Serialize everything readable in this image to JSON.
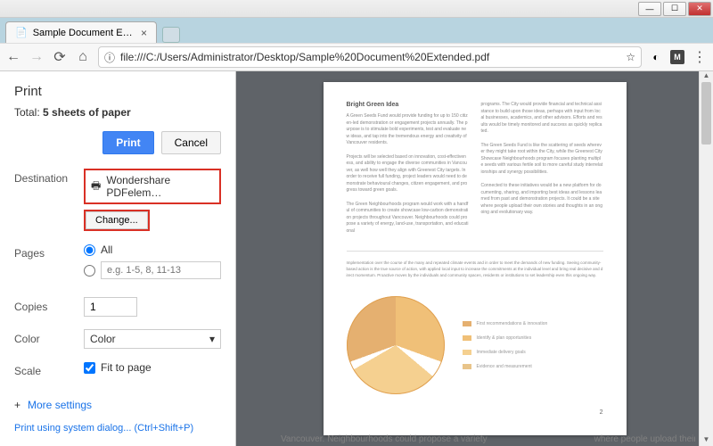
{
  "window": {
    "tab_title": "Sample Document Exte…",
    "url": "file:///C:/Users/Administrator/Desktop/Sample%20Document%20Extended.pdf"
  },
  "print": {
    "title": "Print",
    "total_prefix": "Total: ",
    "total_value": "5 sheets of paper",
    "print_btn": "Print",
    "cancel_btn": "Cancel",
    "destination_label": "Destination",
    "destination_value": "Wondershare PDFelem…",
    "change_btn": "Change...",
    "pages_label": "Pages",
    "pages_all": "All",
    "pages_range_placeholder": "e.g. 1-5, 8, 11-13",
    "copies_label": "Copies",
    "copies_value": "1",
    "color_label": "Color",
    "color_value": "Color",
    "scale_label": "Scale",
    "fit_to_page": "Fit to page",
    "more_settings": "More settings",
    "system_dialog": "Print using system dialog... (Ctrl+Shift+P)"
  },
  "preview": {
    "heading": "Bright Green Idea",
    "page_number": "2",
    "legend": [
      "First recommendations & innovation",
      "Identify & plan opportunities",
      "Immediate delivery goals",
      "Evidence and measurement"
    ],
    "overflow_left": "Vancouver. Neighbourhoods could propose a variety",
    "overflow_right": "where people upload their own stories and thoughts in an"
  },
  "colors": {
    "highlight": "#d93025",
    "primary_btn": "#4285f4"
  }
}
